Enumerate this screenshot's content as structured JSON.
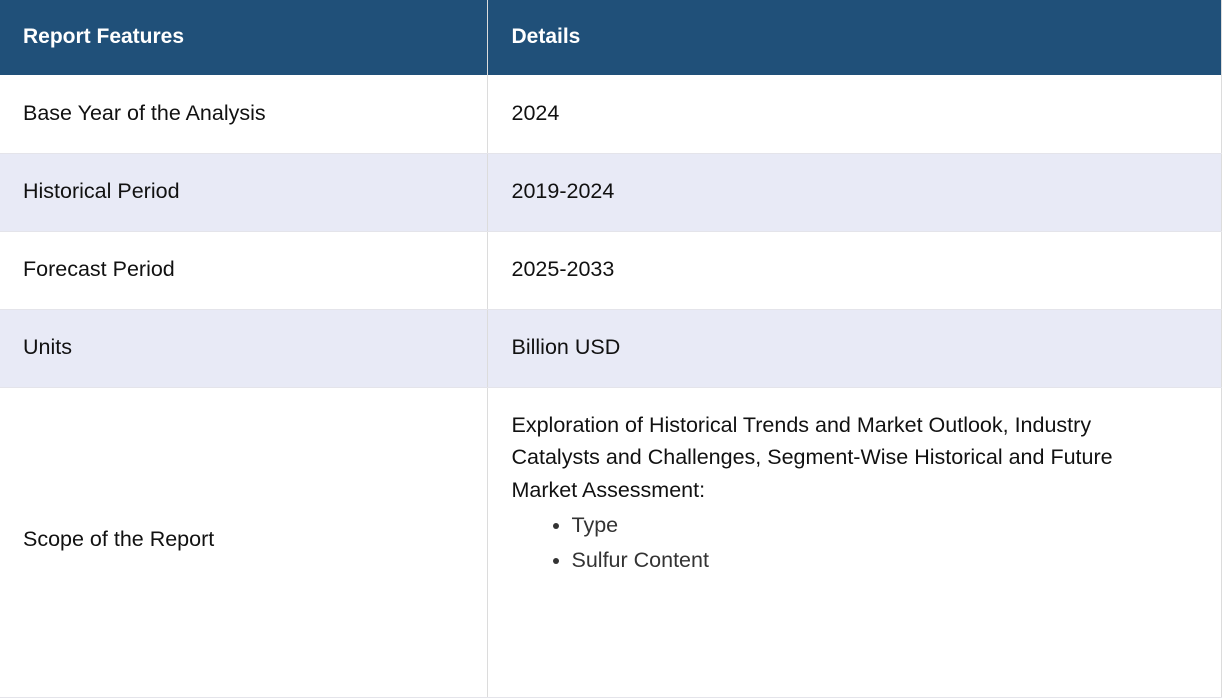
{
  "table": {
    "headers": {
      "feature": "Report Features",
      "details": "Details"
    },
    "rows": [
      {
        "feature": "Base Year of the Analysis",
        "details": "2024"
      },
      {
        "feature": "Historical Period",
        "details": "2019-2024"
      },
      {
        "feature": "Forecast Period",
        "details": "2025-2033"
      },
      {
        "feature": "Units",
        "details": "Billion USD"
      }
    ],
    "scope": {
      "feature": "Scope of the Report",
      "description": "Exploration of Historical Trends and Market Outlook, Industry Catalysts and Challenges, Segment-Wise Historical and Future Market Assessment:",
      "items": [
        "Type",
        "Sulfur Content"
      ]
    }
  },
  "colors": {
    "header_bg": "#205079",
    "header_text": "#ffffff",
    "alt_row_bg": "#e8eaf6"
  }
}
